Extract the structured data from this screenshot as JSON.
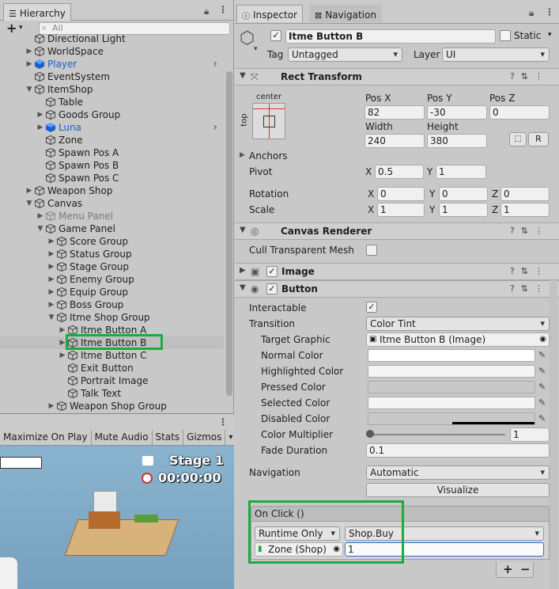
{
  "hierarchy": {
    "tab_label": "Hierarchy",
    "search_placeholder": "All",
    "rows": [
      {
        "label": "Directional Light",
        "depth": 1,
        "arrow": "",
        "prefab": false,
        "dim": false
      },
      {
        "label": "WorldSpace",
        "depth": 1,
        "arrow": "right",
        "prefab": false,
        "dim": false
      },
      {
        "label": "Player",
        "depth": 1,
        "arrow": "right",
        "prefab": true,
        "dim": false,
        "chevron": true
      },
      {
        "label": "EventSystem",
        "depth": 1,
        "arrow": "",
        "prefab": false,
        "dim": false
      },
      {
        "label": "ItemShop",
        "depth": 1,
        "arrow": "down",
        "prefab": false,
        "dim": false
      },
      {
        "label": "Table",
        "depth": 2,
        "arrow": "",
        "prefab": false,
        "dim": false
      },
      {
        "label": "Goods Group",
        "depth": 2,
        "arrow": "right",
        "prefab": false,
        "dim": false
      },
      {
        "label": "Luna",
        "depth": 2,
        "arrow": "right",
        "prefab": true,
        "dim": false,
        "chevron": true
      },
      {
        "label": "Zone",
        "depth": 2,
        "arrow": "",
        "prefab": false,
        "dim": false
      },
      {
        "label": "Spawn Pos A",
        "depth": 2,
        "arrow": "",
        "prefab": false,
        "dim": false
      },
      {
        "label": "Spawn Pos B",
        "depth": 2,
        "arrow": "",
        "prefab": false,
        "dim": false
      },
      {
        "label": "Spawn Pos C",
        "depth": 2,
        "arrow": "",
        "prefab": false,
        "dim": false
      },
      {
        "label": "Weapon Shop",
        "depth": 1,
        "arrow": "right",
        "prefab": false,
        "dim": false
      },
      {
        "label": "Canvas",
        "depth": 1,
        "arrow": "down",
        "prefab": false,
        "dim": false
      },
      {
        "label": "Menu Panel",
        "depth": 2,
        "arrow": "right",
        "prefab": false,
        "dim": true
      },
      {
        "label": "Game Panel",
        "depth": 2,
        "arrow": "down",
        "prefab": false,
        "dim": false
      },
      {
        "label": "Score Group",
        "depth": 3,
        "arrow": "right",
        "prefab": false,
        "dim": false
      },
      {
        "label": "Status Group",
        "depth": 3,
        "arrow": "right",
        "prefab": false,
        "dim": false
      },
      {
        "label": "Stage Group",
        "depth": 3,
        "arrow": "right",
        "prefab": false,
        "dim": false
      },
      {
        "label": "Enemy Group",
        "depth": 3,
        "arrow": "right",
        "prefab": false,
        "dim": false
      },
      {
        "label": "Equip Group",
        "depth": 3,
        "arrow": "right",
        "prefab": false,
        "dim": false
      },
      {
        "label": "Boss Group",
        "depth": 3,
        "arrow": "right",
        "prefab": false,
        "dim": false
      },
      {
        "label": "Itme Shop Group",
        "depth": 3,
        "arrow": "down",
        "prefab": false,
        "dim": false
      },
      {
        "label": "Itme Button A",
        "depth": 4,
        "arrow": "right",
        "prefab": false,
        "dim": false
      },
      {
        "label": "Itme Button B",
        "depth": 4,
        "arrow": "right",
        "prefab": false,
        "dim": false,
        "selected": true
      },
      {
        "label": "Itme Button C",
        "depth": 4,
        "arrow": "right",
        "prefab": false,
        "dim": false
      },
      {
        "label": "Exit Button",
        "depth": 4,
        "arrow": "",
        "prefab": false,
        "dim": false
      },
      {
        "label": "Portrait Image",
        "depth": 4,
        "arrow": "",
        "prefab": false,
        "dim": false
      },
      {
        "label": "Talk Text",
        "depth": 4,
        "arrow": "",
        "prefab": false,
        "dim": false
      },
      {
        "label": "Weapon Shop Group",
        "depth": 3,
        "arrow": "right",
        "prefab": false,
        "dim": false
      }
    ]
  },
  "game": {
    "toolbar": [
      "Maximize On Play",
      "Mute Audio",
      "Stats",
      "Gizmos"
    ],
    "stage_label": "Stage 1",
    "timer": "00:00:00"
  },
  "inspector": {
    "tabs": {
      "inspector": "Inspector",
      "navigation": "Navigation"
    },
    "object_name": "Itme Button B",
    "static_label": "Static",
    "tag_label": "Tag",
    "tag_value": "Untagged",
    "layer_label": "Layer",
    "layer_value": "UI",
    "rect_transform": {
      "title": "Rect Transform",
      "anchor_preset_h": "center",
      "anchor_preset_v": "top",
      "pos_x_label": "Pos X",
      "pos_x": "82",
      "pos_y_label": "Pos Y",
      "pos_y": "-30",
      "pos_z_label": "Pos Z",
      "pos_z": "0",
      "width_label": "Width",
      "width": "240",
      "height_label": "Height",
      "height": "380",
      "r_button": "R",
      "anchors_label": "Anchors",
      "pivot_label": "Pivot",
      "pivot_x": "0.5",
      "pivot_y": "1",
      "rotation_label": "Rotation",
      "rot_x": "0",
      "rot_y": "0",
      "rot_z": "0",
      "scale_label": "Scale",
      "scale_x": "1",
      "scale_y": "1",
      "scale_z": "1",
      "x": "X",
      "y": "Y",
      "z": "Z"
    },
    "canvas_renderer": {
      "title": "Canvas Renderer",
      "cull_label": "Cull Transparent Mesh"
    },
    "image": {
      "title": "Image"
    },
    "button": {
      "title": "Button",
      "interactable_label": "Interactable",
      "transition_label": "Transition",
      "transition_value": "Color Tint",
      "target_graphic_label": "Target Graphic",
      "target_graphic_value": "Itme Button B (Image)",
      "normal_color_label": "Normal Color",
      "highlighted_color_label": "Highlighted Color",
      "pressed_color_label": "Pressed Color",
      "selected_color_label": "Selected Color",
      "disabled_color_label": "Disabled Color",
      "color_multiplier_label": "Color Multiplier",
      "color_multiplier_value": "1",
      "color_multiplier_fraction": 0,
      "fade_duration_label": "Fade Duration",
      "fade_duration_value": "0.1",
      "navigation_label": "Navigation",
      "navigation_value": "Automatic",
      "visualize_label": "Visualize",
      "onclick_label": "On Click ()",
      "runtime_value": "Runtime Only",
      "function_value": "Shop.Buy",
      "object_value": "Zone (Shop)",
      "argument_value": "1",
      "add_label": "+",
      "remove_label": "−"
    }
  },
  "colors": {
    "highlight": "#1faa3b",
    "prefab_blue": "#1a5fd1"
  }
}
